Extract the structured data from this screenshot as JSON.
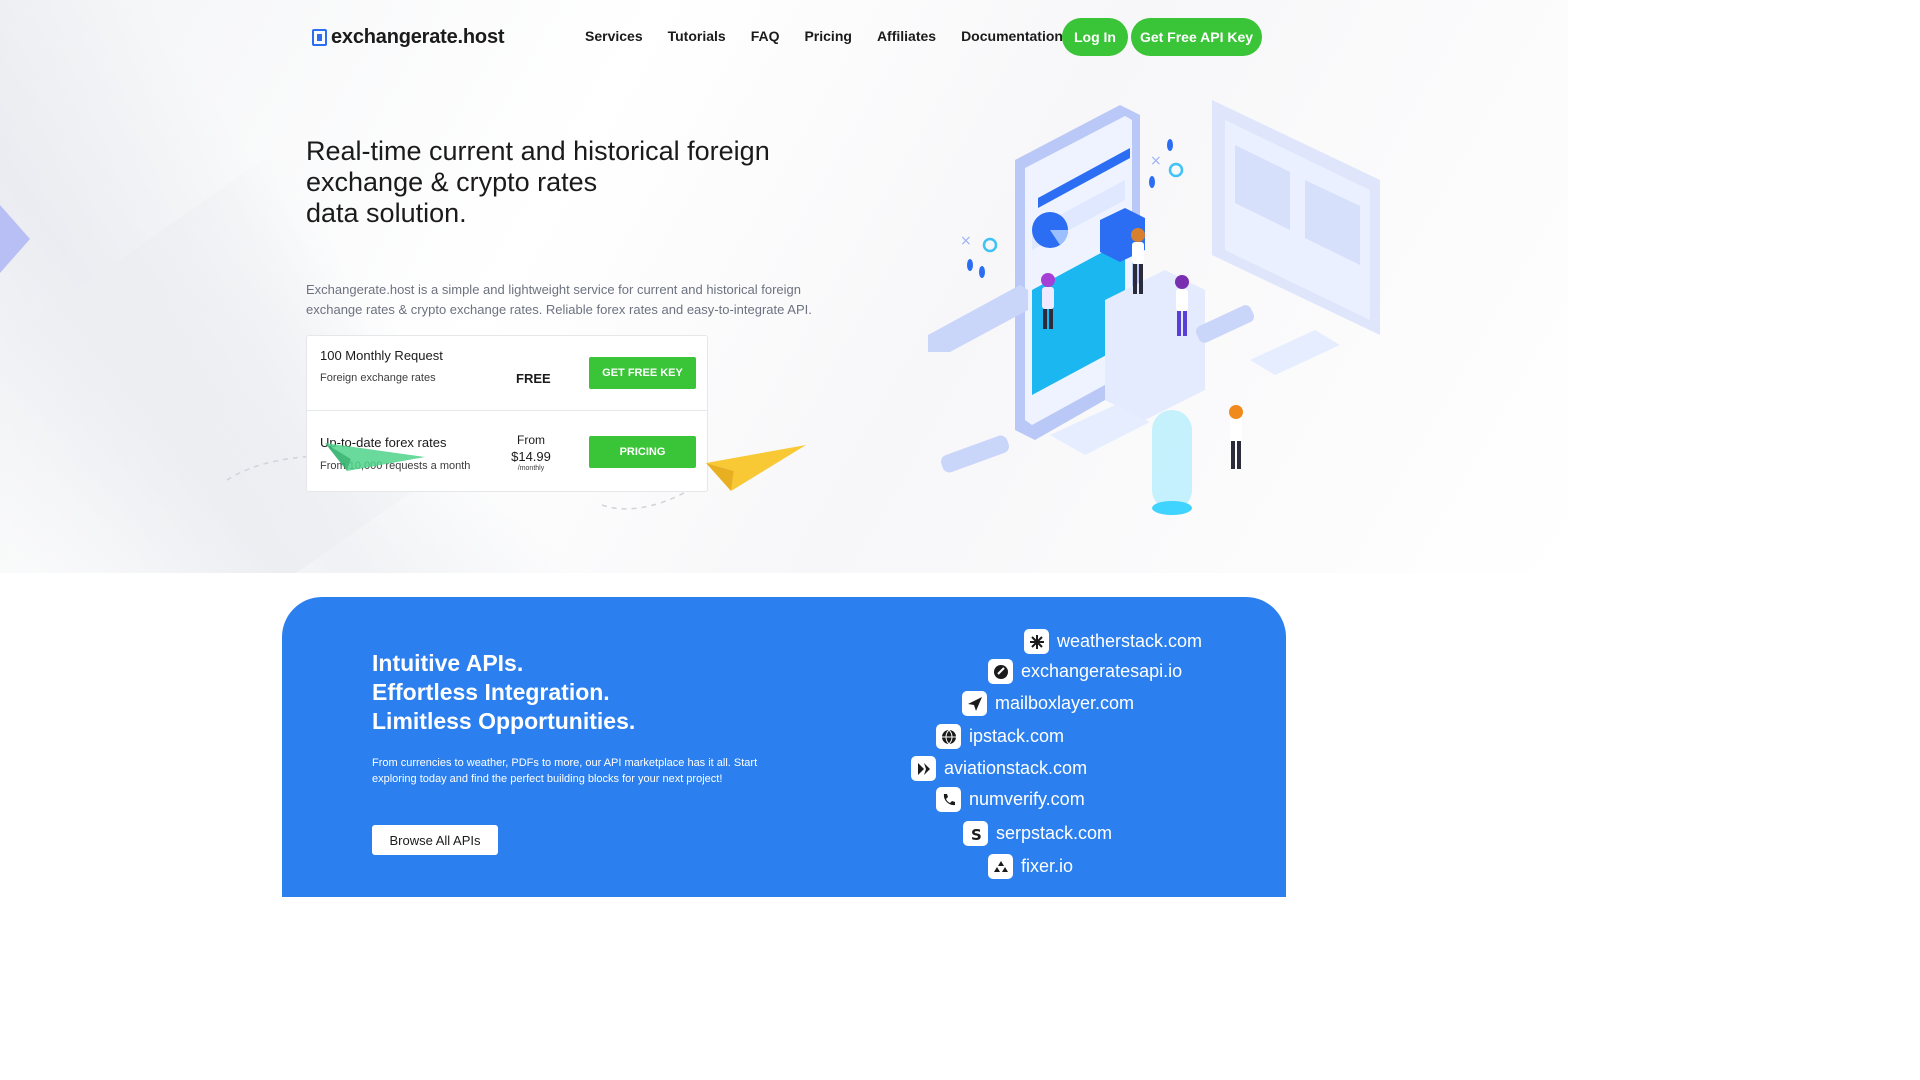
{
  "nav": {
    "logo_text": "exchangerate.host",
    "links": [
      "Services",
      "Tutorials",
      "FAQ",
      "Pricing",
      "Affiliates",
      "Documentation"
    ],
    "login_label": "Log In",
    "api_key_label": "Get Free API Key"
  },
  "hero": {
    "headline_lines": [
      "Real-time current and historical foreign",
      "exchange & crypto rates",
      "data solution."
    ],
    "lead": "Exchangerate.host is a simple and lightweight service for current and historical foreign exchange rates & crypto exchange rates. Reliable forex rates and easy-to-integrate API."
  },
  "plans": [
    {
      "title": "100 Monthly Request",
      "subtitle": "Foreign exchange rates",
      "price": "FREE",
      "button": "GET FREE KEY"
    },
    {
      "title": "Up-to-date forex rates",
      "subtitle": "From 10,000 requests a month",
      "price_prefix": "From",
      "price": "$14.99",
      "price_suffix": "/monthly",
      "button": "PRICING"
    }
  ],
  "marketplace": {
    "title_lines": [
      "Intuitive APIs.",
      "Effortless Integration.",
      "Limitless Opportunities."
    ],
    "description": "From currencies to weather, PDFs to more, our API marketplace has it all. Start exploring today and find the perfect building blocks for your next project!",
    "browse_label": "Browse All APIs",
    "apis": [
      {
        "name": "weatherstack.com",
        "icon": "snowflake-icon"
      },
      {
        "name": "exchangeratesapi.io",
        "icon": "exchange-icon"
      },
      {
        "name": "mailboxlayer.com",
        "icon": "paper-plane-icon"
      },
      {
        "name": "ipstack.com",
        "icon": "globe-icon"
      },
      {
        "name": "aviationstack.com",
        "icon": "aviation-icon"
      },
      {
        "name": "numverify.com",
        "icon": "phone-icon"
      },
      {
        "name": "serpstack.com",
        "icon": "serp-icon"
      },
      {
        "name": "fixer.io",
        "icon": "fixer-icon"
      }
    ]
  },
  "colors": {
    "accent_green": "#3ac437",
    "brand_blue": "#2b7fee",
    "text_dark": "#1b1b1b"
  }
}
